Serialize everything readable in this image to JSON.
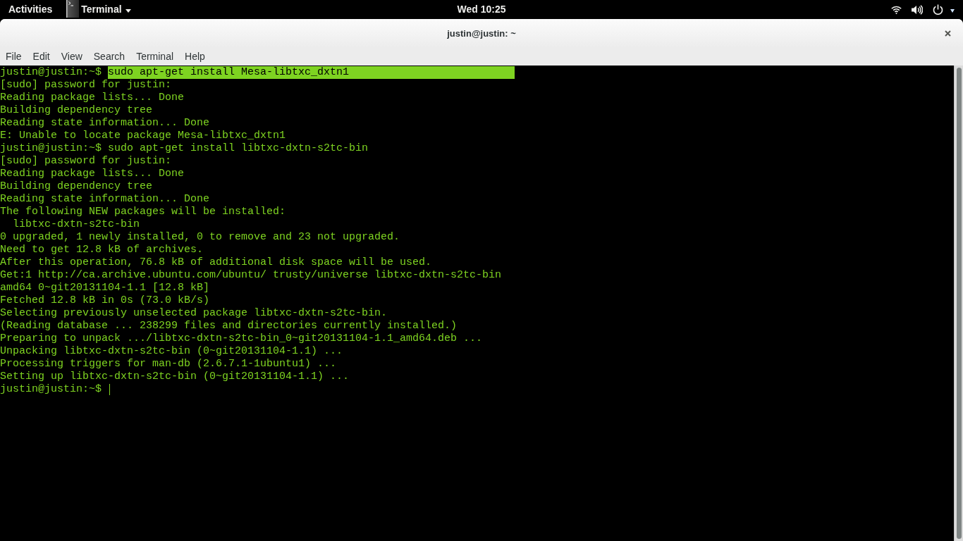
{
  "top_bar": {
    "activities": "Activities",
    "app_menu": "Terminal",
    "clock": "Wed 10:25"
  },
  "window": {
    "title": "justin@justin: ~"
  },
  "menu_bar": [
    "File",
    "Edit",
    "View",
    "Search",
    "Terminal",
    "Help"
  ],
  "terminal": {
    "lines": [
      {
        "kind": "prompt",
        "prompt": "justin@justin:~$",
        "command": "sudo apt-get install Mesa-libtxc_dxtn1",
        "selected": true,
        "cursor": false
      },
      {
        "kind": "output",
        "text": "[sudo] password for justin:",
        "selected": false,
        "cursor": false
      },
      {
        "kind": "output",
        "text": "Reading package lists... Done",
        "selected": false,
        "cursor": false
      },
      {
        "kind": "output",
        "text": "Building dependency tree",
        "selected": false,
        "cursor": false
      },
      {
        "kind": "output",
        "text": "Reading state information... Done",
        "selected": false,
        "cursor": false
      },
      {
        "kind": "output",
        "text": "E: Unable to locate package Mesa-libtxc_dxtn1",
        "selected": false,
        "cursor": false
      },
      {
        "kind": "prompt",
        "prompt": "justin@justin:~$",
        "command": "sudo apt-get install libtxc-dxtn-s2tc-bin",
        "selected": false,
        "cursor": false
      },
      {
        "kind": "output",
        "text": "[sudo] password for justin:",
        "selected": false,
        "cursor": false
      },
      {
        "kind": "output",
        "text": "Reading package lists... Done",
        "selected": false,
        "cursor": false
      },
      {
        "kind": "output",
        "text": "Building dependency tree",
        "selected": false,
        "cursor": false
      },
      {
        "kind": "output",
        "text": "Reading state information... Done",
        "selected": false,
        "cursor": false
      },
      {
        "kind": "output",
        "text": "The following NEW packages will be installed:",
        "selected": false,
        "cursor": false
      },
      {
        "kind": "output",
        "text": "  libtxc-dxtn-s2tc-bin",
        "selected": false,
        "cursor": false
      },
      {
        "kind": "output",
        "text": "0 upgraded, 1 newly installed, 0 to remove and 23 not upgraded.",
        "selected": false,
        "cursor": false
      },
      {
        "kind": "output",
        "text": "Need to get 12.8 kB of archives.",
        "selected": false,
        "cursor": false
      },
      {
        "kind": "output",
        "text": "After this operation, 76.8 kB of additional disk space will be used.",
        "selected": false,
        "cursor": false
      },
      {
        "kind": "output",
        "text": "Get:1 http://ca.archive.ubuntu.com/ubuntu/ trusty/universe libtxc-dxtn-s2tc-bin",
        "selected": false,
        "cursor": false
      },
      {
        "kind": "output",
        "text": "amd64 0~git20131104-1.1 [12.8 kB]",
        "selected": false,
        "cursor": false
      },
      {
        "kind": "output",
        "text": "Fetched 12.8 kB in 0s (73.0 kB/s)",
        "selected": false,
        "cursor": false
      },
      {
        "kind": "output",
        "text": "Selecting previously unselected package libtxc-dxtn-s2tc-bin.",
        "selected": false,
        "cursor": false
      },
      {
        "kind": "output",
        "text": "(Reading database ... 238299 files and directories currently installed.)",
        "selected": false,
        "cursor": false
      },
      {
        "kind": "output",
        "text": "Preparing to unpack .../libtxc-dxtn-s2tc-bin_0~git20131104-1.1_amd64.deb ...",
        "selected": false,
        "cursor": false
      },
      {
        "kind": "output",
        "text": "Unpacking libtxc-dxtn-s2tc-bin (0~git20131104-1.1) ...",
        "selected": false,
        "cursor": false
      },
      {
        "kind": "output",
        "text": "Processing triggers for man-db (2.6.7.1-1ubuntu1) ...",
        "selected": false,
        "cursor": false
      },
      {
        "kind": "output",
        "text": "Setting up libtxc-dxtn-s2tc-bin (0~git20131104-1.1) ...",
        "selected": false,
        "cursor": false
      },
      {
        "kind": "prompt",
        "prompt": "justin@justin:~$",
        "selected": false,
        "cursor": true
      }
    ]
  }
}
